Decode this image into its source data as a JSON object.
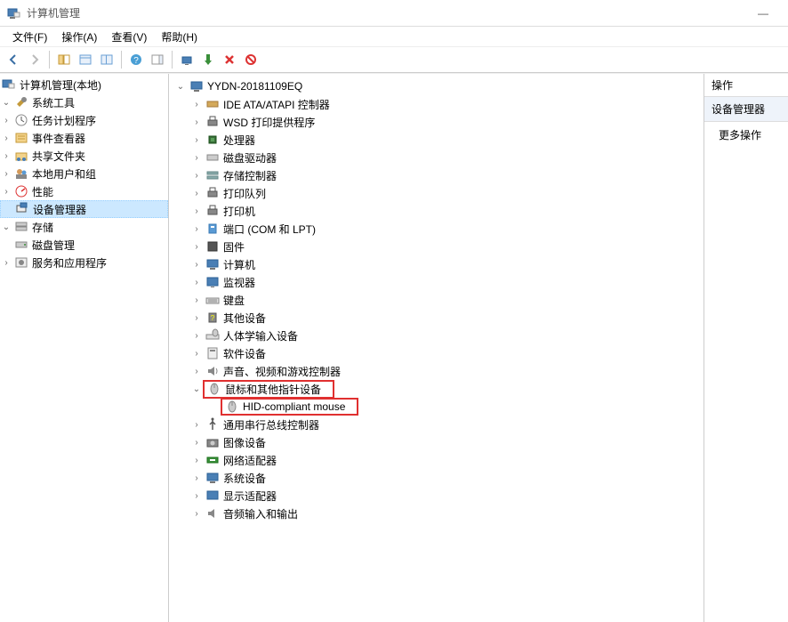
{
  "window": {
    "title": "计算机管理"
  },
  "menu": {
    "file": "文件(F)",
    "action": "操作(A)",
    "view": "查看(V)",
    "help": "帮助(H)"
  },
  "left": {
    "root": "计算机管理(本地)",
    "systools": "系统工具",
    "task": "任务计划程序",
    "event": "事件查看器",
    "shared": "共享文件夹",
    "users": "本地用户和组",
    "perf": "性能",
    "devmgr": "设备管理器",
    "storage": "存储",
    "disk": "磁盘管理",
    "services": "服务和应用程序"
  },
  "dev": {
    "root": "YYDN-20181109EQ",
    "ide": "IDE ATA/ATAPI 控制器",
    "wsd": "WSD 打印提供程序",
    "cpu": "处理器",
    "diskdrive": "磁盘驱动器",
    "storagectrl": "存储控制器",
    "printqueue": "打印队列",
    "printer": "打印机",
    "ports": "端口 (COM 和 LPT)",
    "firmware": "固件",
    "computer": "计算机",
    "monitor": "监视器",
    "keyboard": "键盘",
    "other": "其他设备",
    "hid": "人体学输入设备",
    "software": "软件设备",
    "sound": "声音、视频和游戏控制器",
    "mouse": "鼠标和其他指针设备",
    "hidmouse": "HID-compliant mouse",
    "usb": "通用串行总线控制器",
    "imaging": "图像设备",
    "network": "网络适配器",
    "system": "系统设备",
    "display": "显示适配器",
    "audio": "音频输入和输出"
  },
  "right": {
    "header": "操作",
    "section": "设备管理器",
    "more": "更多操作"
  }
}
